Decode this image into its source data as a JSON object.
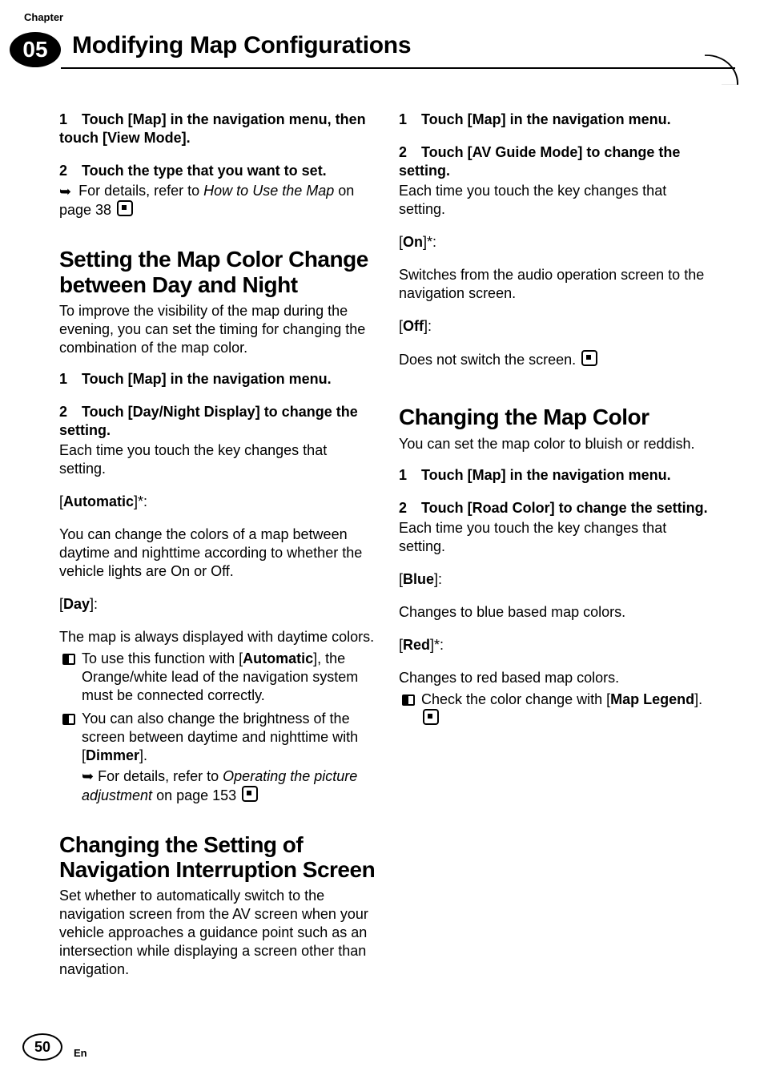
{
  "header": {
    "chapter_label": "Chapter",
    "chapter_number": "05",
    "title": "Modifying Map Configurations"
  },
  "footer": {
    "page_number": "50",
    "lang": "En"
  },
  "left": {
    "s1_step1": "1 Touch [Map] in the navigation menu, then touch [View Mode].",
    "s1_step2": "2 Touch the type that you want to set.",
    "s1_detail_pre": "For details, refer to ",
    "s1_detail_em": "How to Use the Map",
    "s1_detail_post": " on page 38",
    "h2a": "Setting the Map Color Change between Day and Night",
    "h2a_lead": "To improve the visibility of the map during the evening, you can set the timing for changing the combination of the map color.",
    "h2a_step1": "1 Touch [Map] in the navigation menu.",
    "h2a_step2": "2 Touch [Day/Night Display] to change the setting.",
    "h2a_each": "Each time you touch the key changes that setting.",
    "h2a_auto_label": "Automatic",
    "h2a_auto_desc": "You can change the colors of a map between daytime and nighttime according to whether the vehicle lights are On or Off.",
    "h2a_day_label": "Day",
    "h2a_day_desc": "The map is always displayed with daytime colors.",
    "h2a_b1_pre": "To use this function with [",
    "h2a_b1_bold": "Automatic",
    "h2a_b1_post": "], the Orange/white lead of the navigation system must be connected correctly.",
    "h2a_b2_pre": "You can also change the brightness of the screen between daytime and nighttime with [",
    "h2a_b2_bold": "Dimmer",
    "h2a_b2_post": "].",
    "h2a_b2_det_pre": "For details, refer to ",
    "h2a_b2_det_em": "Operating the picture adjustment",
    "h2a_b2_det_post": " on page 153",
    "h2b": "Changing the Setting of Navigation Interruption Screen",
    "h2b_lead": "Set whether to automatically switch to the navigation screen from the AV screen when your vehicle approaches a guidance point such as an intersection while displaying a screen other than navigation."
  },
  "right": {
    "r_step1": "1 Touch [Map] in the navigation menu.",
    "r_step2": "2 Touch [AV Guide Mode] to change the setting.",
    "r_each": "Each time you touch the key changes that setting.",
    "r_on_label": "On",
    "r_on_desc": "Switches from the audio operation screen to the navigation screen.",
    "r_off_label": "Off",
    "r_off_desc": "Does not switch the screen.",
    "h2c": "Changing the Map Color",
    "h2c_lead": "You can set the map color to bluish or reddish.",
    "h2c_step1": "1 Touch [Map] in the navigation menu.",
    "h2c_step2": "2 Touch [Road Color] to change the setting.",
    "h2c_each": "Each time you touch the key changes that setting.",
    "h2c_blue_label": "Blue",
    "h2c_blue_desc": "Changes to blue based map colors.",
    "h2c_red_label": "Red",
    "h2c_red_desc": "Changes to red based map colors.",
    "h2c_b1_pre": "Check the color change with [",
    "h2c_b1_bold": "Map Legend",
    "h2c_b1_post": "]."
  },
  "glyphs": {
    "arrow": "➥"
  }
}
